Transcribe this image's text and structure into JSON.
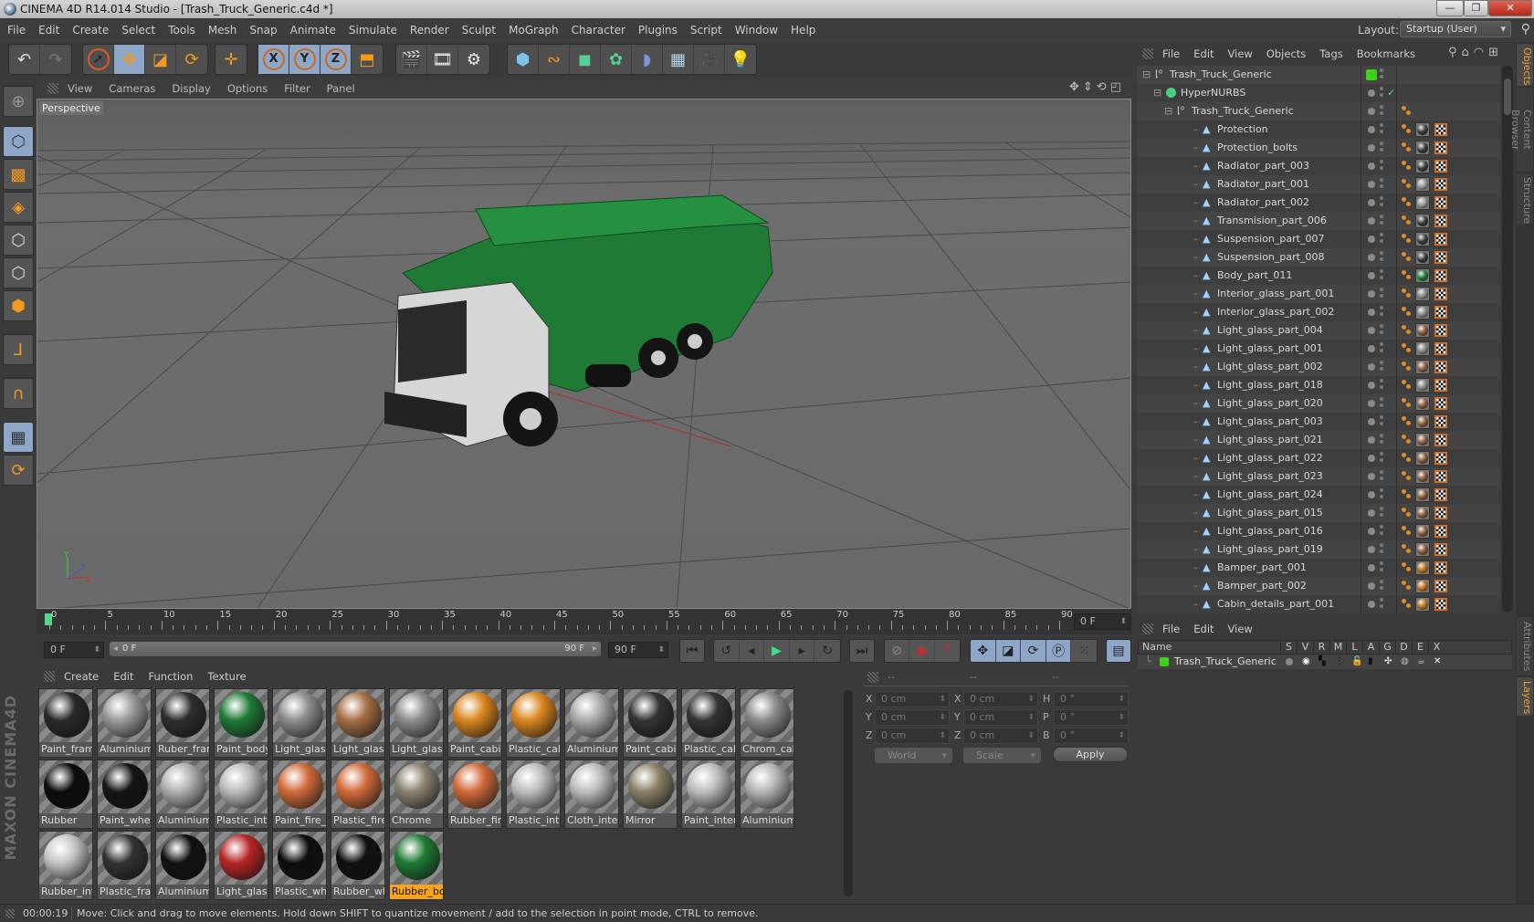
{
  "window": {
    "title": "CINEMA 4D R14.014 Studio - [Trash_Truck_Generic.c4d *]",
    "min": "—",
    "max": "❐",
    "close": "✕"
  },
  "menubar": [
    "File",
    "Edit",
    "Create",
    "Select",
    "Tools",
    "Mesh",
    "Snap",
    "Animate",
    "Simulate",
    "Render",
    "Sculpt",
    "MoGraph",
    "Character",
    "Plugins",
    "Script",
    "Window",
    "Help"
  ],
  "layout": {
    "label": "Layout:",
    "value": "Startup (User)"
  },
  "toolbar": {
    "history": [
      "undo-icon",
      "redo-icon"
    ],
    "tools": [
      "select-arrow-icon",
      "move-icon",
      "scale-icon",
      "rotate-icon",
      "axis-move-icon"
    ],
    "axes": [
      "X",
      "Y",
      "Z",
      "world-coordinates-icon"
    ],
    "render": [
      "render-view-icon",
      "render-picture-viewer-icon",
      "render-settings-icon"
    ],
    "objects": [
      "cube-icon",
      "spline-icon",
      "nurbs-icon",
      "mograph-cloner-icon",
      "deformer-icon",
      "floor-icon",
      "camera-icon",
      "light-icon"
    ]
  },
  "left_toolbar": [
    "make-editable",
    "model-mode",
    "texture-mode",
    "workplane-mode",
    "points-mode",
    "edges-mode",
    "polygons-mode",
    "axis-mode",
    "snap-magnet",
    "locked-workplane",
    "workplane-rotate"
  ],
  "viewport": {
    "menu": [
      "View",
      "Cameras",
      "Display",
      "Options",
      "Filter",
      "Panel"
    ],
    "label": "Perspective",
    "axis_labels": [
      "Y",
      "Z",
      "X"
    ]
  },
  "timeline": {
    "ticks": [
      "0",
      "5",
      "10",
      "15",
      "20",
      "25",
      "30",
      "35",
      "40",
      "45",
      "50",
      "55",
      "60",
      "65",
      "70",
      "75",
      "80",
      "85",
      "90"
    ],
    "current_frame": "0 F",
    "start_field": "0 F",
    "range_start": "0 F",
    "range_end": "90 F",
    "end_field": "90 F"
  },
  "materials": {
    "menu": [
      "Create",
      "Edit",
      "Function",
      "Texture"
    ],
    "items": [
      {
        "label": "Paint_fram",
        "color": "#2a2a2a"
      },
      {
        "label": "Aluminium_",
        "color": "#9a9a9a"
      },
      {
        "label": "Ruber_fram",
        "color": "#2e2e2e"
      },
      {
        "label": "Paint_body",
        "color": "#1f7a35"
      },
      {
        "label": "Light_glass",
        "color": "#8d8d8d"
      },
      {
        "label": "Light_glass",
        "color": "#a56e44"
      },
      {
        "label": "Light_glass",
        "color": "#8d8d8d"
      },
      {
        "label": "Paint_cabir",
        "color": "#d9861f"
      },
      {
        "label": "Plastic_cab",
        "color": "#d9861f"
      },
      {
        "label": "Aluminium_",
        "color": "#aaaaaa"
      },
      {
        "label": "Paint_cabir",
        "color": "#333333"
      },
      {
        "label": "Plastic_cab",
        "color": "#333333"
      },
      {
        "label": "Chrom_cab",
        "color": "#8a8a8a"
      },
      {
        "label": "Rubber",
        "color": "#0c0c0c"
      },
      {
        "label": "Paint_whee",
        "color": "#151515"
      },
      {
        "label": "Aluminium_",
        "color": "#b0b0b0"
      },
      {
        "label": "Plastic_inte",
        "color": "#bbbbbb"
      },
      {
        "label": "Paint_fire_e",
        "color": "#d06a3a"
      },
      {
        "label": "Plastic_fire_",
        "color": "#d06a3a"
      },
      {
        "label": "Chrome",
        "color": "#8a8270"
      },
      {
        "label": "Rubber_fir",
        "color": "#d06a3a"
      },
      {
        "label": "Plastic_inte",
        "color": "#bdbdbd"
      },
      {
        "label": "Cloth_inter",
        "color": "#bdbdbd"
      },
      {
        "label": "Mirror",
        "color": "#8a8068"
      },
      {
        "label": "Paint_inter",
        "color": "#bdbdbd"
      },
      {
        "label": "Aluminium_",
        "color": "#b5b5b5"
      },
      {
        "label": "Rubber_int",
        "color": "#c5c5c5"
      },
      {
        "label": "Plastic_fran",
        "color": "#333333"
      },
      {
        "label": "Aluminium_",
        "color": "#111111"
      },
      {
        "label": "Light_glass",
        "color": "#b82525"
      },
      {
        "label": "Plastic_whe",
        "color": "#0e0e0e"
      },
      {
        "label": "Rubber_wh",
        "color": "#101010"
      },
      {
        "label": "Rubber_bo",
        "color": "#1f7a35",
        "selected": true
      }
    ]
  },
  "coordinates": {
    "headers": [
      "--",
      "--",
      "--"
    ],
    "position": [
      {
        "axis": "X",
        "value": "0 cm"
      },
      {
        "axis": "Y",
        "value": "0 cm"
      },
      {
        "axis": "Z",
        "value": "0 cm"
      }
    ],
    "size": [
      {
        "axis": "X",
        "value": "0 cm"
      },
      {
        "axis": "Y",
        "value": "0 cm"
      },
      {
        "axis": "Z",
        "value": "0 cm"
      }
    ],
    "rotation": [
      {
        "axis": "H",
        "value": "0 °"
      },
      {
        "axis": "P",
        "value": "0 °"
      },
      {
        "axis": "B",
        "value": "0 °"
      }
    ],
    "mode": "World",
    "transform": "Scale",
    "apply": "Apply"
  },
  "objects": {
    "menu": [
      "File",
      "Edit",
      "View",
      "Objects",
      "Tags",
      "Bookmarks"
    ],
    "rows": [
      {
        "name": "Trash_Truck_Generic",
        "level": 0,
        "type": "null"
      },
      {
        "name": "HyperNURBS",
        "level": 1,
        "type": "hypernurbs"
      },
      {
        "name": "Trash_Truck_Generic",
        "level": 2,
        "type": "null"
      },
      {
        "name": "Protection",
        "level": 3,
        "mat": "#3a3a3a"
      },
      {
        "name": "Protection_bolts",
        "level": 3,
        "mat": "#3a3a3a"
      },
      {
        "name": "Radiator_part_003",
        "level": 3,
        "mat": "#3a3a3a"
      },
      {
        "name": "Radiator_part_001",
        "level": 3,
        "mat": "#9a9a9a"
      },
      {
        "name": "Radiator_part_002",
        "level": 3,
        "mat": "#9a9a9a"
      },
      {
        "name": "Transmision_part_006",
        "level": 3,
        "mat": "#3a3a3a"
      },
      {
        "name": "Suspension_part_007",
        "level": 3,
        "mat": "#3a3a3a"
      },
      {
        "name": "Suspension_part_008",
        "level": 3,
        "mat": "#3a3a3a"
      },
      {
        "name": "Body_part_011",
        "level": 3,
        "mat": "#1f7a35"
      },
      {
        "name": "Interior_glass_part_001",
        "level": 3,
        "mat": "#8a8a8a"
      },
      {
        "name": "Interior_glass_part_002",
        "level": 3,
        "mat": "#8a8a8a"
      },
      {
        "name": "Light_glass_part_004",
        "level": 3,
        "mat": "#8a5a3a"
      },
      {
        "name": "Light_glass_part_001",
        "level": 3,
        "mat": "#8a8a8a"
      },
      {
        "name": "Light_glass_part_002",
        "level": 3,
        "mat": "#8a5a3a"
      },
      {
        "name": "Light_glass_part_018",
        "level": 3,
        "mat": "#8a8a8a"
      },
      {
        "name": "Light_glass_part_020",
        "level": 3,
        "mat": "#8a5a3a"
      },
      {
        "name": "Light_glass_part_003",
        "level": 3,
        "mat": "#8a5a3a"
      },
      {
        "name": "Light_glass_part_021",
        "level": 3,
        "mat": "#8a5a3a"
      },
      {
        "name": "Light_glass_part_022",
        "level": 3,
        "mat": "#8a5a3a"
      },
      {
        "name": "Light_glass_part_023",
        "level": 3,
        "mat": "#8a5a3a"
      },
      {
        "name": "Light_glass_part_024",
        "level": 3,
        "mat": "#8a5a3a"
      },
      {
        "name": "Light_glass_part_015",
        "level": 3,
        "mat": "#8a5a3a"
      },
      {
        "name": "Light_glass_part_016",
        "level": 3,
        "mat": "#8a5a3a"
      },
      {
        "name": "Light_glass_part_019",
        "level": 3,
        "mat": "#8a5a3a"
      },
      {
        "name": "Bamper_part_001",
        "level": 3,
        "mat": "#c0701a"
      },
      {
        "name": "Bamper_part_002",
        "level": 3,
        "mat": "#c0701a"
      },
      {
        "name": "Cabin_details_part_001",
        "level": 3,
        "mat": "#c0701a"
      }
    ]
  },
  "side_tabs": {
    "top": [
      "Objects",
      "Content Browser",
      "Structure"
    ],
    "bottom": [
      "Attributes",
      "Layers"
    ]
  },
  "layers": {
    "menu": [
      "File",
      "Edit",
      "View"
    ],
    "columns": [
      "Name",
      "S",
      "V",
      "R",
      "M",
      "L",
      "A",
      "G",
      "D",
      "E",
      "X"
    ],
    "rows": [
      {
        "name": "Trash_Truck_Generic",
        "color": "#3fd11a"
      }
    ]
  },
  "status": {
    "time": "00:00:19",
    "message": "Move: Click and drag to move elements. Hold down SHIFT to quantize movement / add to the selection in point mode, CTRL to remove."
  },
  "colors": {
    "accent": "#f29a20",
    "active_tool": "#8ea6c8",
    "layer_green": "#3fd11a",
    "truck_body": "#1f7a35"
  }
}
